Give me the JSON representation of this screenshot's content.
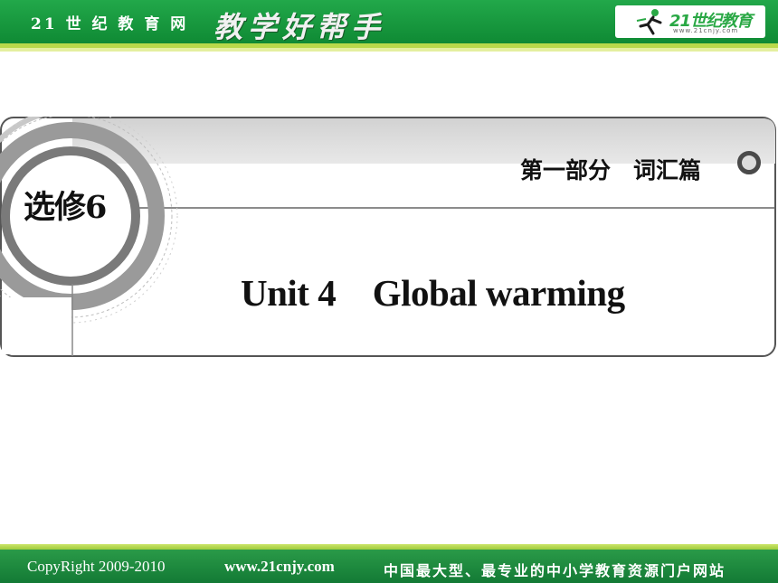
{
  "header": {
    "brand": "21 世 纪 教 育 网",
    "slogan": "教学好帮手",
    "logo_text": "21世纪教育",
    "logo_url": "www.21cnjy.com",
    "logo_icon": "running-figure-icon"
  },
  "slide": {
    "book": "选修6",
    "part": "第一部分　词汇篇",
    "unit_title": "Unit 4　Global warming"
  },
  "footer": {
    "copyright": "CopyRight 2009-2010",
    "website": "www.21cnjy.com",
    "slogan": "中国最大型、最专业的中小学教育资源门户网站"
  },
  "colors": {
    "header_green": "#149539",
    "accent_lime": "#b9d94a",
    "panel_gray": "#d6d6d6",
    "text": "#111111"
  }
}
